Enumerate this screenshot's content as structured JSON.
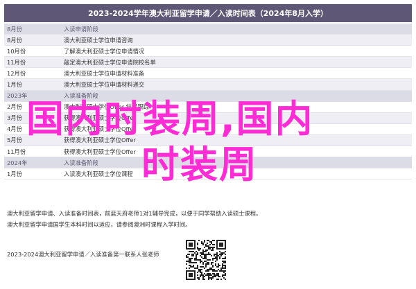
{
  "title": "2023-2024学年澳大利亚留学申请／入读时间表（2024年8月入学）",
  "rows": [
    {
      "type": "group",
      "date": "8月份",
      "event": "入读申请阶段"
    },
    {
      "type": "sub",
      "date": "8月份",
      "event": "澳大利亚硕士学位申请咨询"
    },
    {
      "type": "white",
      "date": "10月份",
      "event": "了解澳大利亚硕士学位申请情况"
    },
    {
      "type": "sub",
      "date": "11月份",
      "event": "敲定澳大利亚硕士学位申请院校名单"
    },
    {
      "type": "white",
      "date": "12月份",
      "event": "澳大利亚硕士学位申请材料准备"
    },
    {
      "type": "sub",
      "date": "1月份",
      "event": "澳大利亚硕士学位申请材料递交"
    },
    {
      "type": "group",
      "date": "2023年",
      "event": "入读准备阶段"
    },
    {
      "type": "white",
      "date": "2月份",
      "event": "澳大利亚硕士学位Offer 结果跟踪"
    },
    {
      "type": "sub",
      "date": "3月份",
      "event": "获得澳大利亚硕士学位Offer"
    },
    {
      "type": "white",
      "date": "4月份",
      "event": "获得澳大利亚硕士学位Offer"
    },
    {
      "type": "sub",
      "date": "5月份",
      "event": "获得澳大利亚硕士学位Offer"
    },
    {
      "type": "white",
      "date": "11月份",
      "event": "获得澳大利亚硕士学位Offer"
    },
    {
      "type": "group",
      "date": "2024年",
      "event": "入读准备阶段"
    },
    {
      "type": "white",
      "date": "1月份",
      "event": "入读澳大利亚硕士学位课程"
    }
  ],
  "notes": [
    "澳大利亚留学申请、入读准备时间表，前蓝天府老师1对1辅导完成，以便于同学帮助入读硕士课程。",
    "澳大利亚留学申请国学生本科时间以适应，请参阅澳洲时课程入学时间。"
  ],
  "bottom_text": "2023-2024澳大利亚留学申请／入读准备第一联系人张老师",
  "overlay": {
    "line1": "国内时装周,国内",
    "line2": "时装周",
    "color": "#ff2bd5"
  },
  "colors": {
    "title_bg": "#5e5775",
    "group_bg": "#dcdce6",
    "sub_bg": "#eeeef4"
  }
}
